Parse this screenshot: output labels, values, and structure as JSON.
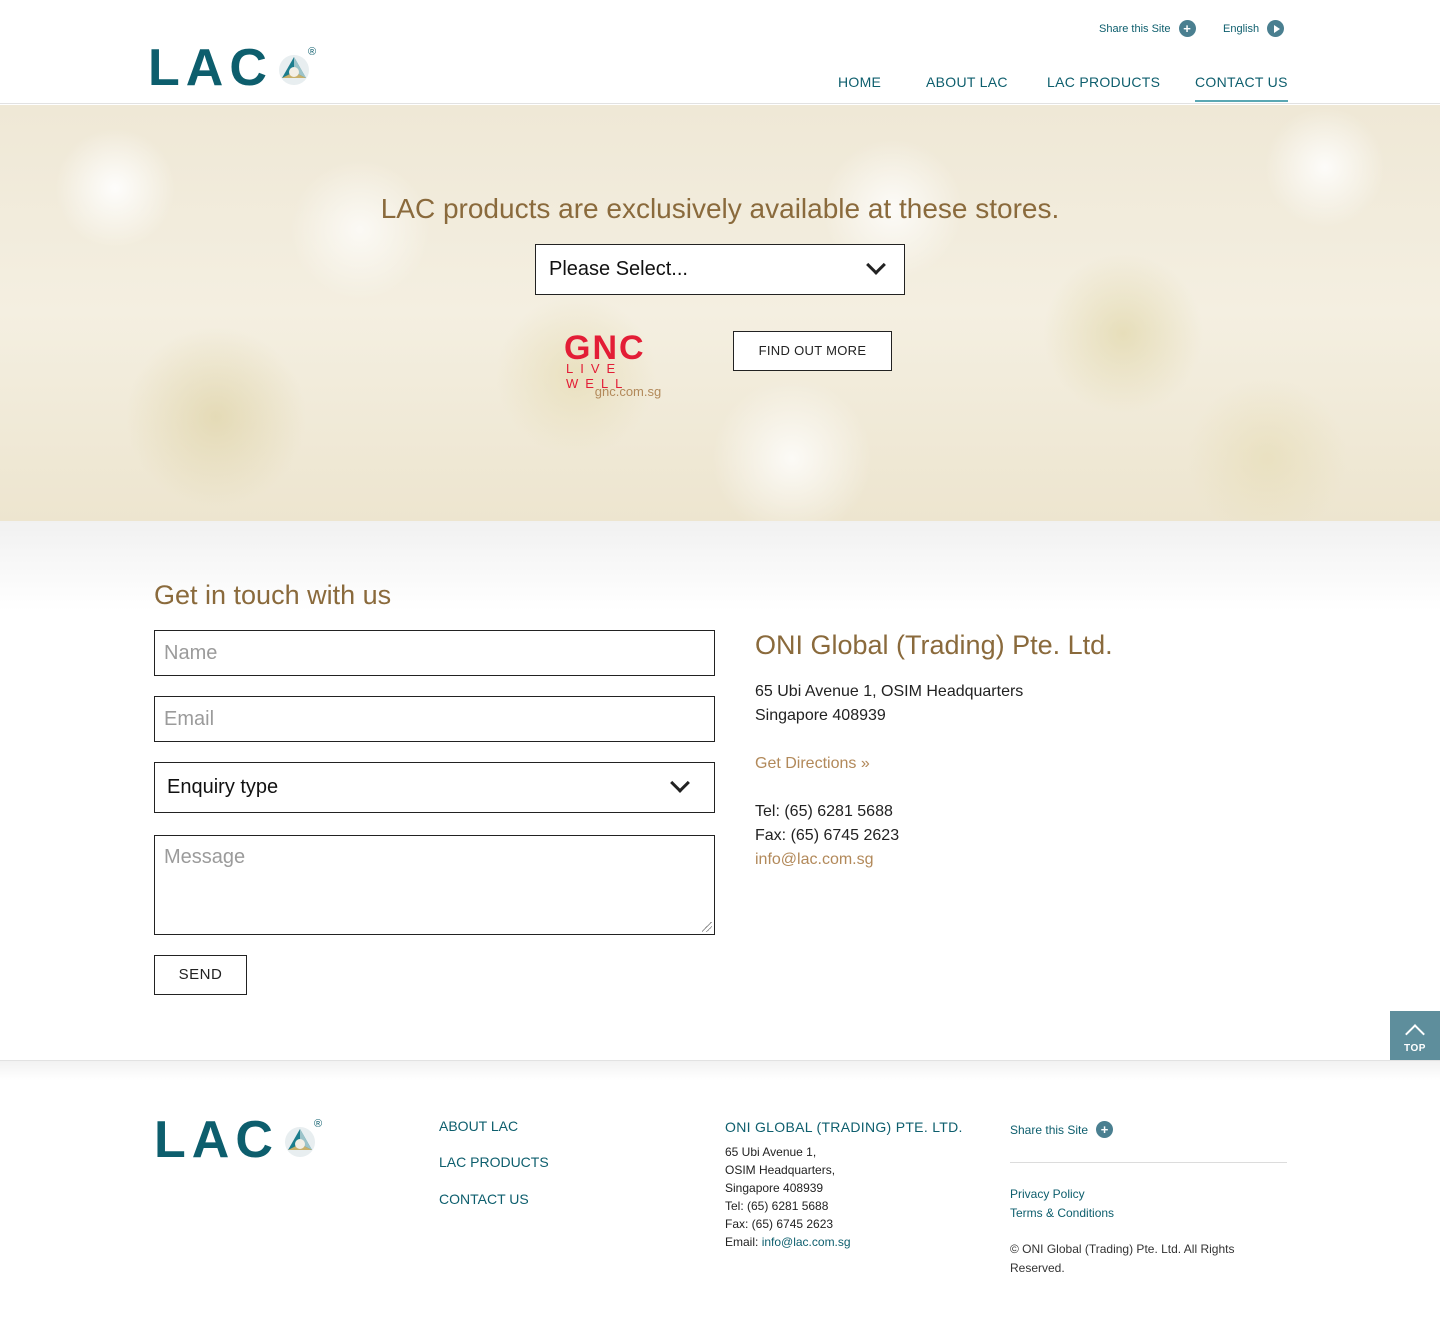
{
  "brand": {
    "logo_text": "LAC",
    "registered": "®"
  },
  "utility": {
    "share_label": "Share this Site",
    "language_label": "English"
  },
  "nav": {
    "items": [
      {
        "label": "HOME"
      },
      {
        "label": "ABOUT LAC"
      },
      {
        "label": "LAC PRODUCTS"
      },
      {
        "label": "CONTACT US",
        "active": true
      }
    ]
  },
  "hero": {
    "title": "LAC products are exclusively available at these stores.",
    "store_select": {
      "selected": "Please Select..."
    },
    "store": {
      "logo_main": "GNC",
      "logo_sub": "LIVE WELL",
      "link": "gnc.com.sg"
    },
    "find_out_more": "FIND OUT MORE"
  },
  "contact": {
    "title": "Get in touch with us",
    "form": {
      "name_placeholder": "Name",
      "email_placeholder": "Email",
      "enquiry_selected": "Enquiry type",
      "message_placeholder": "Message",
      "send_label": "SEND"
    },
    "company": {
      "name": "ONI Global (Trading) Pte. Ltd.",
      "address_line1": "65 Ubi Avenue 1, OSIM Headquarters",
      "address_line2": "Singapore 408939",
      "directions": "Get Directions »",
      "tel": "Tel: (65) 6281 5688",
      "fax": "Fax: (65) 6745 2623",
      "email": "info@lac.com.sg"
    }
  },
  "back_to_top": {
    "label": "TOP"
  },
  "footer": {
    "nav": [
      {
        "label": "ABOUT LAC"
      },
      {
        "label": "LAC PRODUCTS"
      },
      {
        "label": "CONTACT US"
      }
    ],
    "company": {
      "title": "ONI GLOBAL (TRADING) PTE. LTD.",
      "lines": [
        "65 Ubi Avenue 1,",
        "OSIM Headquarters,",
        "Singapore 408939",
        "Tel: (65) 6281 5688",
        "Fax: (65) 6745 2623"
      ],
      "email_label": "Email: ",
      "email": "info@lac.com.sg"
    },
    "share_label": "Share this Site",
    "links": {
      "privacy": "Privacy Policy",
      "terms": "Terms & Conditions"
    },
    "copyright": "© ONI Global (Trading) Pte. Ltd. All Rights Reserved."
  },
  "colors": {
    "brand_teal": "#0d5e6d",
    "gold": "#8a6a3c",
    "link_gold": "#b2895a",
    "gnc_red": "#e31d36",
    "top_button": "#5e8e9c"
  },
  "icons": [
    "plus-circle-icon",
    "play-circle-icon",
    "chevron-down-icon",
    "chevron-up-icon",
    "logo-mark-icon"
  ]
}
